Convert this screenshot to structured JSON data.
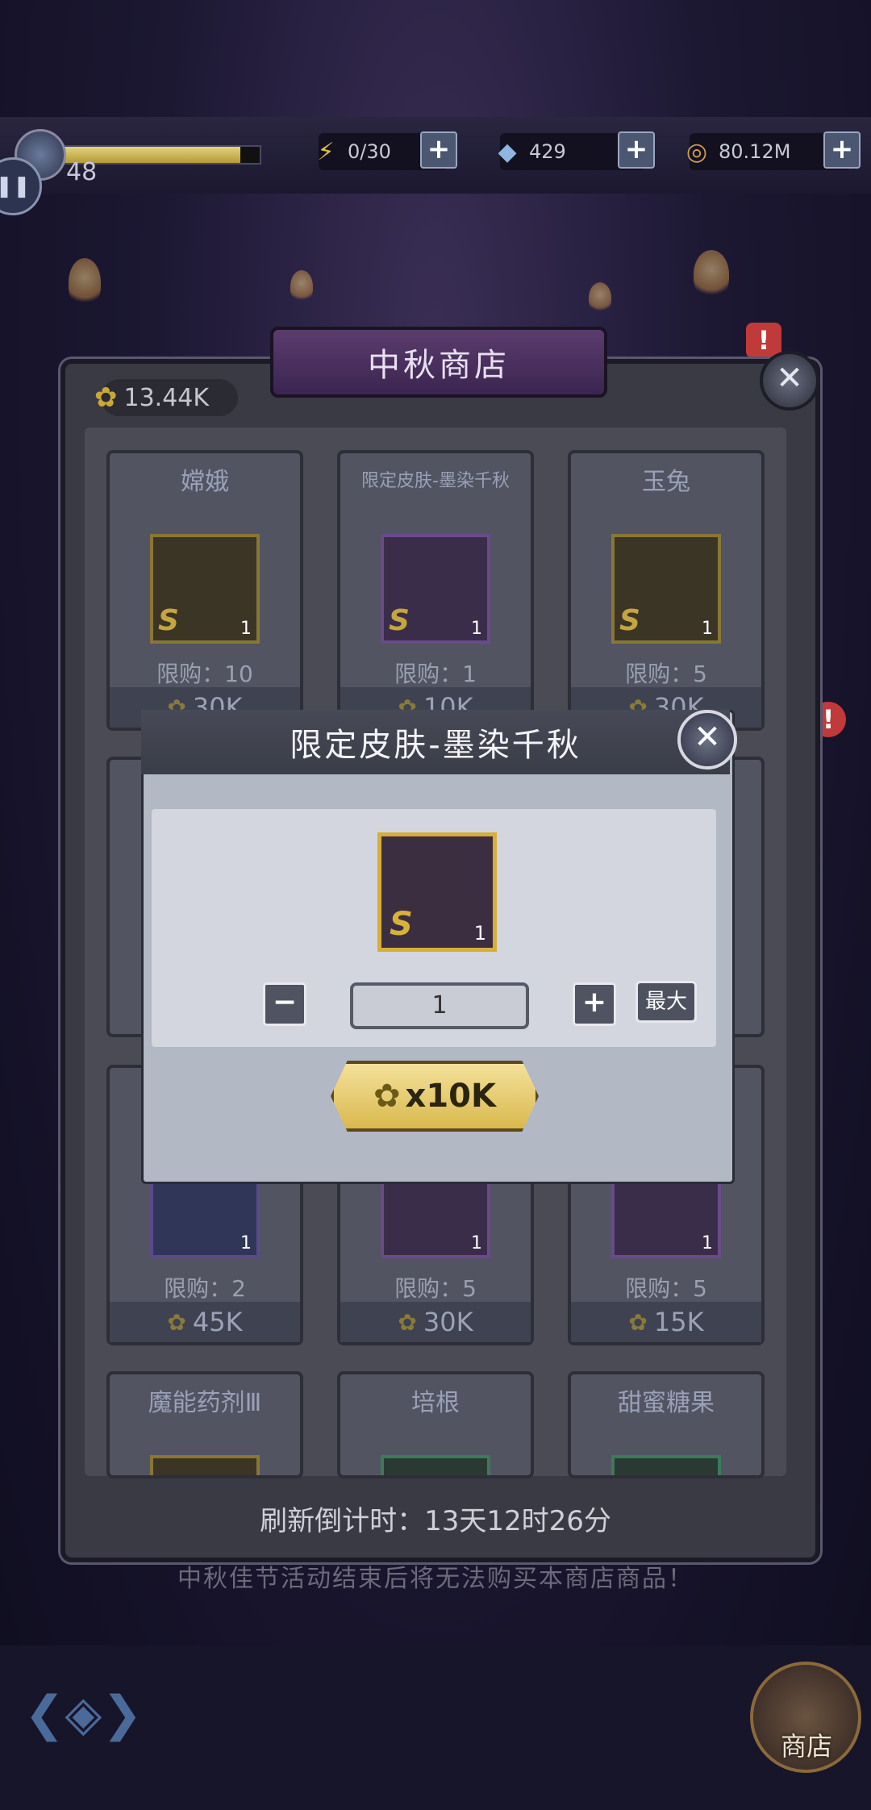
{
  "topbar": {
    "level": "48",
    "energy": "0/30",
    "gems": "429",
    "coins": "80.12M"
  },
  "shop": {
    "title": "中秋商店",
    "currency_amount": "13.44K",
    "items": [
      {
        "name": "嫦娥",
        "limit": "限购：10",
        "price": "30K",
        "count": "1",
        "rarity": "S"
      },
      {
        "name": "限定皮肤-墨染千秋",
        "limit": "限购：1",
        "price": "10K",
        "count": "1",
        "rarity": "S"
      },
      {
        "name": "玉兔",
        "limit": "限购：5",
        "price": "30K",
        "count": "1",
        "rarity": "S"
      },
      {
        "name": "",
        "limit": "限购：2",
        "price": "45K",
        "count": "1",
        "rarity": ""
      },
      {
        "name": "",
        "limit": "限购：5",
        "price": "30K",
        "count": "1",
        "rarity": ""
      },
      {
        "name": "",
        "limit": "限购：5",
        "price": "15K",
        "count": "1",
        "rarity": ""
      },
      {
        "name": "魔能药剂Ⅲ",
        "limit": "",
        "price": "",
        "count": "",
        "rarity": ""
      },
      {
        "name": "培根",
        "limit": "",
        "price": "",
        "count": "",
        "rarity": ""
      },
      {
        "name": "甜蜜糖果",
        "limit": "",
        "price": "",
        "count": "",
        "rarity": ""
      }
    ],
    "refresh_text": "刷新倒计时：13天12时26分",
    "notice": "中秋佳节活动结束后将无法购买本商店商品！",
    "shop_button_label": "商店"
  },
  "dialog": {
    "title": "限定皮肤-墨染千秋",
    "rarity": "S",
    "count": "1",
    "minus": "−",
    "plus": "+",
    "quantity": "1",
    "max_label": "最大",
    "price_label": "x10K"
  },
  "colors": {
    "accent_gold": "#d9b94e",
    "alert_red": "#c03a3a"
  }
}
